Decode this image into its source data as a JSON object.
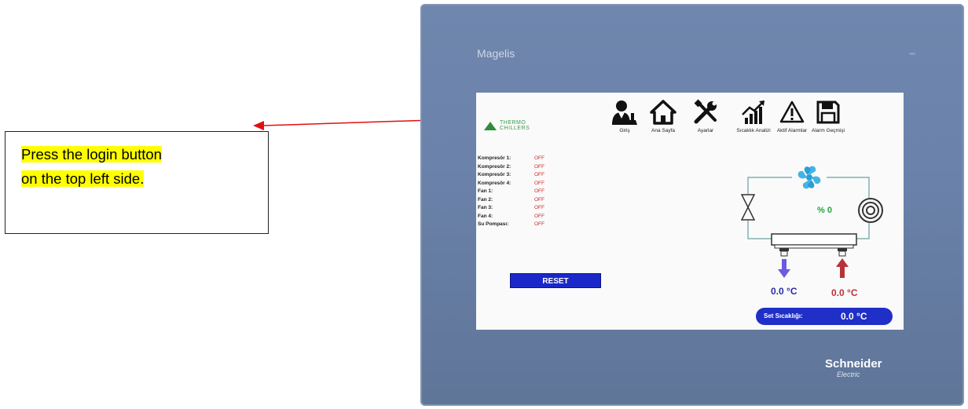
{
  "callout": {
    "line1": "Press the login button",
    "line2": "on the top left side."
  },
  "device": {
    "brand": "Magelis",
    "manufacturer": "Schneider",
    "manufacturer_sub": "Electric"
  },
  "screen": {
    "logo_line1": "THERMO",
    "logo_line2": "CHILLERS",
    "menu": [
      {
        "label": "Giriş",
        "icon": "login-user-icon"
      },
      {
        "label": "Ana Sayfa",
        "icon": "home-icon"
      },
      {
        "label": "Ayarlar",
        "icon": "tools-icon"
      },
      {
        "label": "Sıcaklık Analizi",
        "icon": "chart-icon"
      },
      {
        "label": "Aktif Alarmlar",
        "icon": "warning-icon"
      },
      {
        "label": "Alarm Geçmişi",
        "icon": "save-icon"
      }
    ],
    "status": [
      {
        "name": "Kompresör 1:",
        "value": "OFF"
      },
      {
        "name": "Kompresör 2:",
        "value": "OFF"
      },
      {
        "name": "Kompresör 3:",
        "value": "OFF"
      },
      {
        "name": "Kompresör 4:",
        "value": "OFF"
      },
      {
        "name": "Fan 1:",
        "value": "OFF"
      },
      {
        "name": "Fan 2:",
        "value": "OFF"
      },
      {
        "name": "Fan 3:",
        "value": "OFF"
      },
      {
        "name": "Fan 4:",
        "value": "OFF"
      },
      {
        "name": "Su Pompası:",
        "value": "OFF"
      }
    ],
    "reset_label": "RESET",
    "fan_percent": "% 0",
    "inlet_temp": "0.0 °C",
    "outlet_temp": "0.0 °C",
    "setpoint_label": "Set Sıcaklığı:",
    "setpoint_value": "0.0 °C"
  },
  "colors": {
    "device_body": "#6b82aa",
    "reset_blue": "#1a28c9",
    "status_off": "#cc2a2a",
    "cold_arrow": "#6a5be0",
    "hot_arrow": "#b8323a",
    "highlight": "#ffff00",
    "arrow_red": "#e01010"
  }
}
